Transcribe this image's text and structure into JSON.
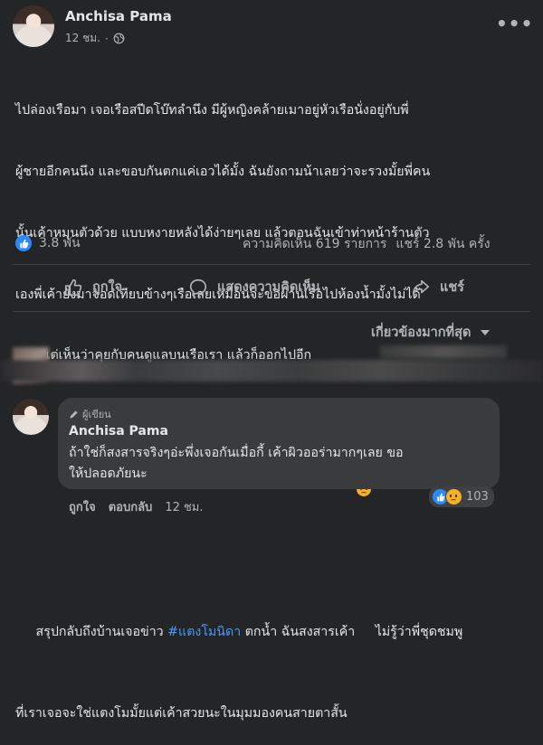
{
  "post": {
    "author": "Anchisa Pama",
    "time": "12 ชม.",
    "text_lines": [
      "ไปล่องเรือมา เจอเรือสปีดโบ๊ทลำนึง มีผู้หญิงคล้ายเมาอยู่หัวเรือนั่งอยู่กับพี่",
      "ผู้ชายอีกคนนึง และขอบกันตกแค่เอวได้มั้ง ฉันยังถามน้าเลยว่าจะรวงมั้ยพี่คน",
      "นั้นเค้าหมุนตัวด้วย แบบหงายหลังได้ง่ายๆเลย แล้วตอนฉันเข้าท่าหน้าร้านตัว",
      "เองพี่เค้ายังมาจอดเทียบข้างๆเรือเลยเหมือนจะขอผ่านเรือไปห้องน้ำมั้งไม่ได้",
      "มอง แต่เห็นว่าคุยกับคนดูแลบนเรือเรา แล้วก็ออกไปอีก"
    ],
    "text2_before_tag": " สรุปกลับถึงบ้านเจอข่าว ",
    "hashtag": "#แตงโมนิดา",
    "text2_after_tag": " ตกน้ำ ฉันสงสารเค้า",
    "text2_after_emoji": " ไม่รู้ว่าพี่ชุดชมพู",
    "text2_line2": "ที่เราเจอจะใช่แตงโมมั้ยแต่เค้าสวยนะในมุมมองคนสายตาสั้น"
  },
  "stats": {
    "reactions": "3.8 พัน",
    "comments": "ความคิดเห็น 619 รายการ",
    "shares": "แชร์ 2.8 พัน ครั้ง"
  },
  "actions": {
    "like": "ถูกใจ",
    "comment": "แสดงความคิดเห็น",
    "share": "แชร์"
  },
  "sort": {
    "label": "เกี่ยวข้องมากที่สุด"
  },
  "comment": {
    "badge": "ผู้เขียน",
    "author": "Anchisa Pama",
    "line1": "ถ้าใช่ก็สงสารจริงๆอ่ะพึ่งเจอกันเมื่อกี้ เค้าผิวออร่ามากๆเลย ขอ",
    "line2": "ให้ปลอดภัยนะ",
    "like": "ถูกใจ",
    "reply": "ตอบกลับ",
    "time": "12 ชม.",
    "reaction_count": "103"
  },
  "colors": {
    "background": "#242526",
    "bubble": "#3a3b3c",
    "link": "#4599ff",
    "like_blue": "#2d88ff"
  }
}
